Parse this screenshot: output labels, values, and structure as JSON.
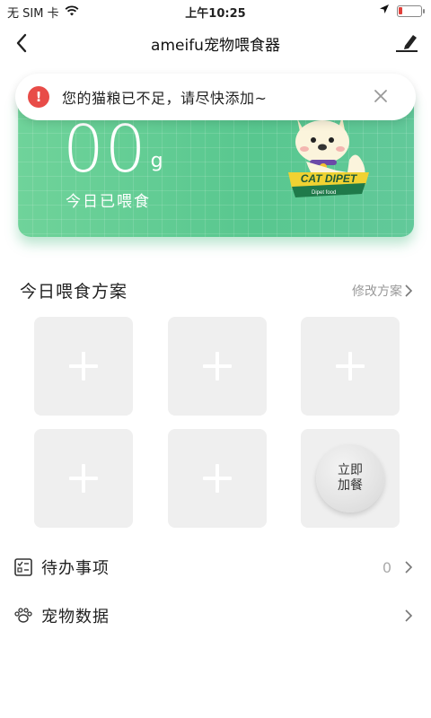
{
  "status_bar": {
    "carrier": "无 SIM 卡",
    "time": "上午10:25",
    "battery_level": 0.15
  },
  "navbar": {
    "title": "ameifu宠物喂食器",
    "back_icon": "chevron-left-icon",
    "edit_icon": "pencil-icon"
  },
  "alert": {
    "message": "您的猫粮已不足，请尽快添加~",
    "icon": "!"
  },
  "feed_card": {
    "amount": "00",
    "unit": "g",
    "label": "今日已喂食",
    "mascot_label": "CAT DIPET",
    "mascot_sublabel": "Dipet food"
  },
  "plan": {
    "title": "今日喂食方案",
    "edit_link": "修改方案",
    "tiles_empty_count": 5,
    "extra_meal_line1": "立即",
    "extra_meal_line2": "加餐"
  },
  "list": [
    {
      "label": "待办事项",
      "count": "0",
      "icon": "checklist-icon"
    },
    {
      "label": "宠物数据",
      "count": "",
      "icon": "paw-icon"
    }
  ],
  "colors": {
    "card_green": "#58c78f",
    "alert_red": "#e84c48",
    "tile_gray": "#efefef"
  }
}
